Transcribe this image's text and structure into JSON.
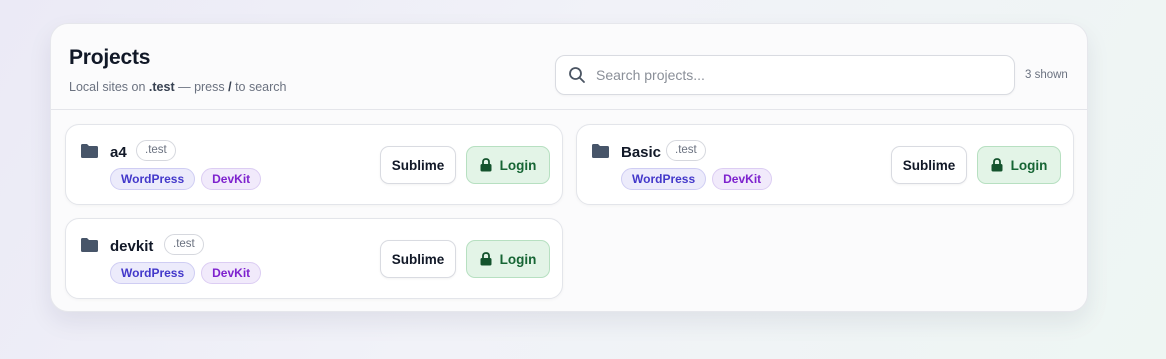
{
  "header": {
    "title": "Projects",
    "subtitle_pre": "Local sites on ",
    "subtitle_tld": ".test",
    "subtitle_mid": " — press ",
    "subtitle_key": "/",
    "subtitle_post": " to search"
  },
  "search": {
    "placeholder": "Search projects...",
    "value": "",
    "icon": "search-icon"
  },
  "count_label": "3 shown",
  "projects": [
    {
      "name": "a4",
      "tld": ".test",
      "tags": [
        "WordPress",
        "DevKit"
      ],
      "editor_label": "Sublime",
      "login_label": "Login"
    },
    {
      "name": "Basic",
      "tld": ".test",
      "tags": [
        "WordPress",
        "DevKit"
      ],
      "editor_label": "Sublime",
      "login_label": "Login"
    },
    {
      "name": "devkit",
      "tld": ".test",
      "tags": [
        "WordPress",
        "DevKit"
      ],
      "editor_label": "Sublime",
      "login_label": "Login"
    }
  ],
  "icons": {
    "folder": "folder-icon",
    "lock": "lock-icon"
  },
  "colors": {
    "wordpress_tag": "#4338ca",
    "devkit_tag": "#7e22ce",
    "login_bg": "#e3f4e7",
    "login_text": "#166534"
  }
}
